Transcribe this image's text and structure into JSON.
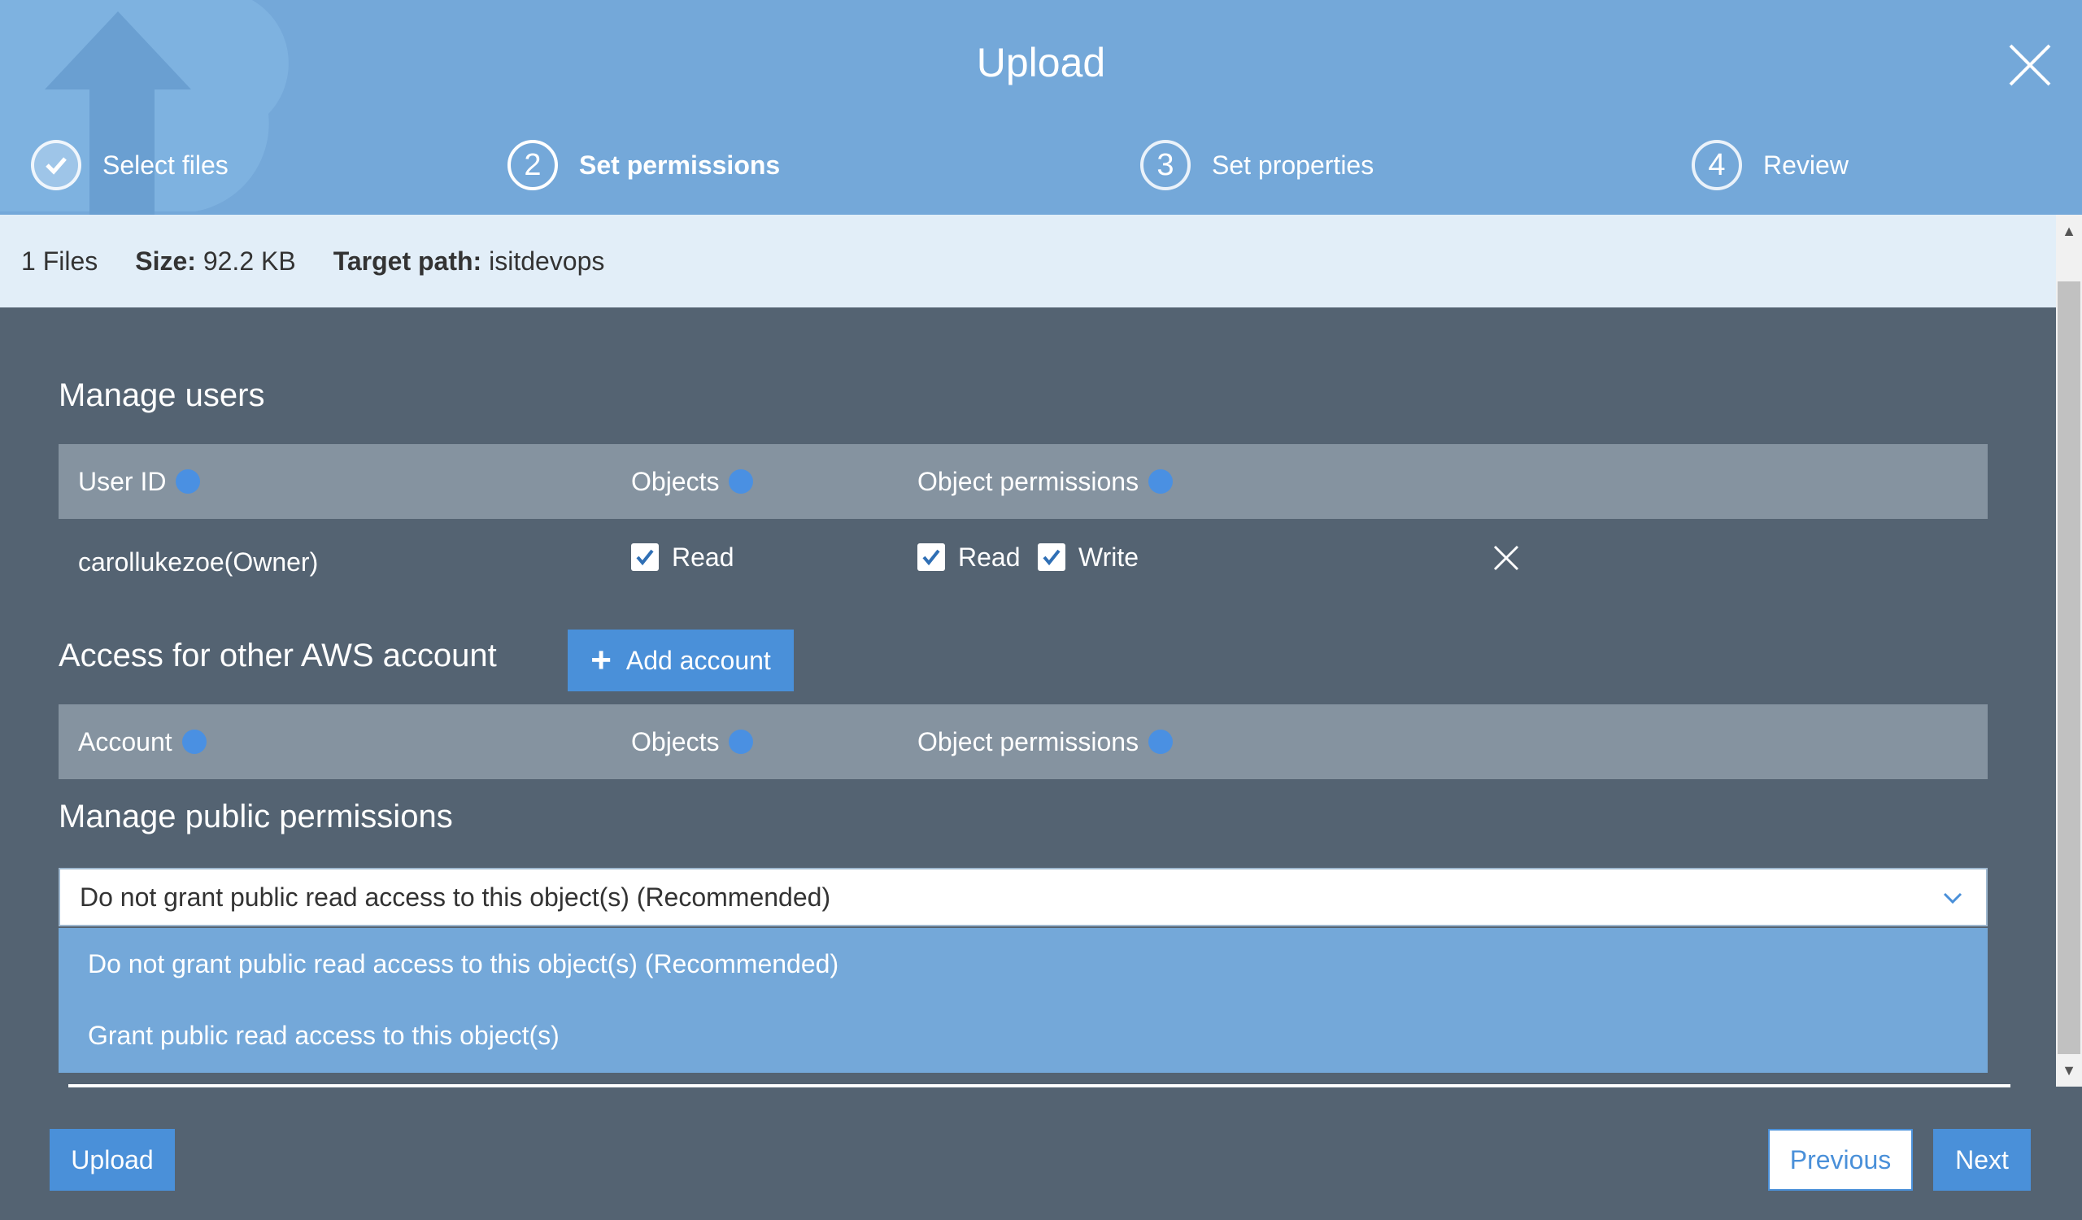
{
  "colors": {
    "header": "#74a8d9",
    "accent": "#4a90d9",
    "panel": "#546372",
    "table_header": "#8593a0",
    "infobar": "#e2eef8"
  },
  "header": {
    "title": "Upload",
    "close_icon": "close-icon",
    "steps": [
      {
        "number": "✓",
        "label": "Select files",
        "state": "done"
      },
      {
        "number": "2",
        "label": "Set permissions",
        "state": "active"
      },
      {
        "number": "3",
        "label": "Set properties",
        "state": "pending"
      },
      {
        "number": "4",
        "label": "Review",
        "state": "pending"
      }
    ]
  },
  "infobar": {
    "files": "1 Files",
    "size_label": "Size:",
    "size_value": "92.2 KB",
    "path_label": "Target path:",
    "path_value": "isitdevops"
  },
  "manage_users": {
    "title": "Manage users",
    "columns": [
      "User ID",
      "Objects",
      "Object permissions"
    ],
    "rows": [
      {
        "user": "carollukezoe(Owner)",
        "objects_read": "Read",
        "perm_read": "Read",
        "perm_write": "Write"
      }
    ]
  },
  "other_accounts": {
    "title": "Access for other AWS account",
    "add_button": "Add account",
    "columns": [
      "Account",
      "Objects",
      "Object permissions"
    ]
  },
  "public_permissions": {
    "title": "Manage public permissions",
    "selected": "Do not grant public read access to this object(s) (Recommended)",
    "options": [
      "Do not grant public read access to this object(s) (Recommended)",
      "Grant public read access to this object(s)"
    ]
  },
  "footer": {
    "upload": "Upload",
    "previous": "Previous",
    "next": "Next"
  }
}
